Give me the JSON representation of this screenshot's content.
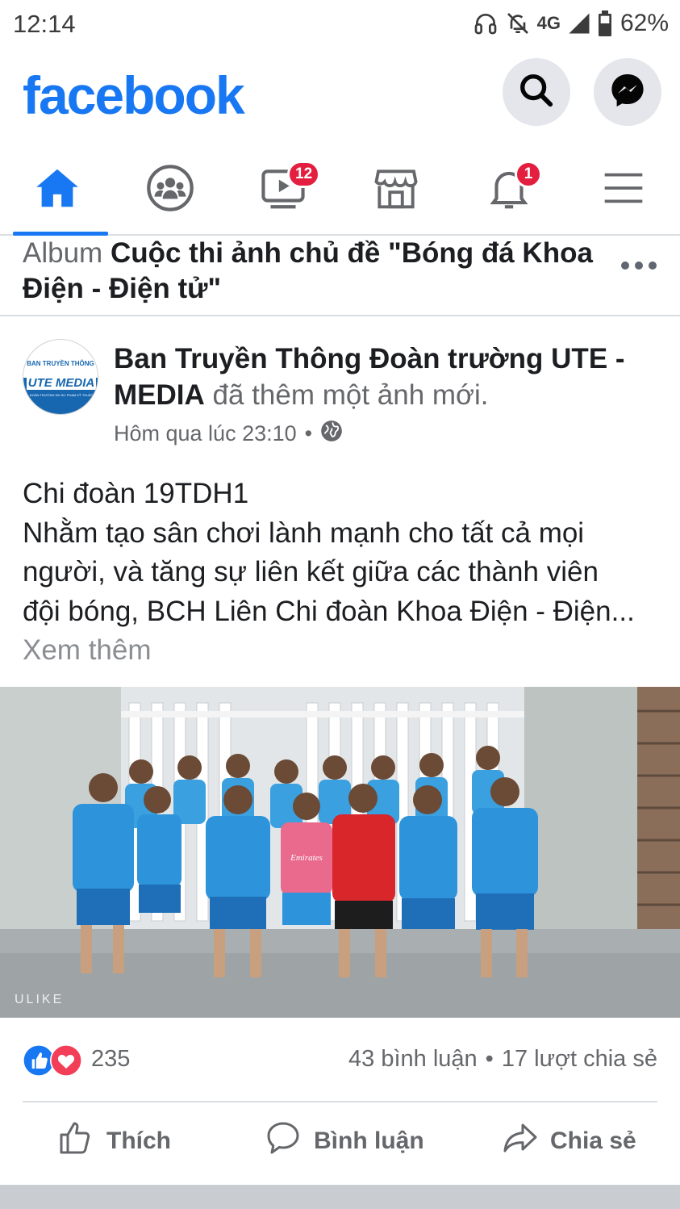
{
  "status_bar": {
    "time": "12:14",
    "network": "4G",
    "battery": "62%",
    "icons": [
      "headphones-icon",
      "bell-off-icon",
      "signal-icon",
      "battery-icon"
    ]
  },
  "header": {
    "logo": "facebook",
    "brand_color": "#1877f2",
    "buttons": [
      "search-icon",
      "messenger-icon"
    ]
  },
  "tabs": [
    {
      "name": "home-icon",
      "active": true,
      "badge": ""
    },
    {
      "name": "groups-icon",
      "active": false,
      "badge": ""
    },
    {
      "name": "watch-icon",
      "active": false,
      "badge": "12"
    },
    {
      "name": "marketplace-icon",
      "active": false,
      "badge": ""
    },
    {
      "name": "notifications-icon",
      "active": false,
      "badge": "1"
    },
    {
      "name": "menu-icon",
      "active": false,
      "badge": ""
    }
  ],
  "album": {
    "prefix": "Album",
    "title_line1": "Cuộc thi ảnh chủ đề \"Bóng đá Khoa",
    "title_line2": "Điện - Điện tử\""
  },
  "post": {
    "author_line1": "Ban Truyền Thông Đoàn trường UTE -",
    "author_line2": "MEDIA",
    "action": "đã thêm một ảnh mới.",
    "timestamp": "Hôm qua lúc 23:10",
    "separator": "•",
    "privacy_icon": "globe-icon",
    "avatar_text": {
      "top": "BAN TRUYỀN THÔNG",
      "main": "UTE MEDIA",
      "bottom": "ĐOÀN TRƯỜNG ĐH SƯ PHẠM KỸ THUẬT"
    },
    "text_lines": [
      "Chi đoàn 19TDH1",
      "Nhằm tạo sân chơi lành mạnh cho tất cả mọi",
      "người, và tăng sự liên kết giữa các thành viên",
      "đội bóng, BCH Liên Chi đoàn Khoa Điện - Điện..."
    ],
    "see_more": "Xem thêm",
    "photo_watermark": "ULIKE",
    "jersey_text": "Emirates"
  },
  "engagement": {
    "reaction_icons": [
      "like-icon",
      "love-icon"
    ],
    "reaction_count": "235",
    "comments": "43 bình luận",
    "shares": "17 lượt chia sẻ",
    "separator": "•"
  },
  "actions": {
    "like": "Thích",
    "comment": "Bình luận",
    "share": "Chia sẻ"
  }
}
